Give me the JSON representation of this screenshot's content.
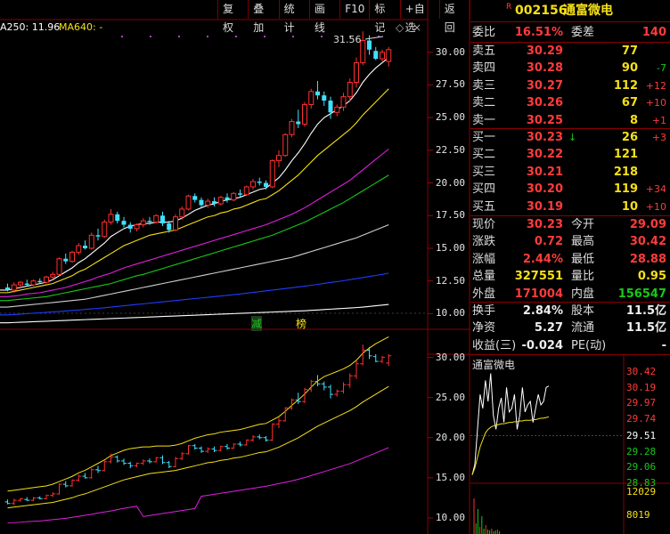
{
  "toolbar": [
    "复权",
    "叠加",
    "统计",
    "画线",
    "F10",
    "标记",
    "+自选",
    "返回"
  ],
  "ma_labels": [
    {
      "text": "A250: 11.96",
      "color": "#ffffff"
    },
    {
      "text": "MA640: -",
      "color": "#f5e016"
    }
  ],
  "annotations": {
    "high_label": "31.56",
    "marker1": "减",
    "marker2": "榜"
  },
  "stock": {
    "badge": "R",
    "code": "002156",
    "name": "通富微电"
  },
  "quote": {
    "weibi_label": "委比",
    "weibi": "16.51%",
    "weicha_label": "委差",
    "weicha": "140",
    "sells": [
      {
        "label": "卖五",
        "price": "30.29",
        "vol": "77",
        "chg": ""
      },
      {
        "label": "卖四",
        "price": "30.28",
        "vol": "90",
        "chg": "-7"
      },
      {
        "label": "卖三",
        "price": "30.27",
        "vol": "112",
        "chg": "+12"
      },
      {
        "label": "卖二",
        "price": "30.26",
        "vol": "67",
        "chg": "+10"
      },
      {
        "label": "卖一",
        "price": "30.25",
        "vol": "8",
        "chg": "+1"
      }
    ],
    "buys": [
      {
        "label": "买一",
        "price": "30.23",
        "vol": "26",
        "chg": "+3",
        "arrow": "↓"
      },
      {
        "label": "买二",
        "price": "30.22",
        "vol": "121",
        "chg": "",
        "arrow": ""
      },
      {
        "label": "买三",
        "price": "30.21",
        "vol": "218",
        "chg": "",
        "arrow": ""
      },
      {
        "label": "买四",
        "price": "30.20",
        "vol": "119",
        "chg": "+34",
        "arrow": ""
      },
      {
        "label": "买五",
        "price": "30.19",
        "vol": "10",
        "chg": "+10",
        "arrow": ""
      }
    ],
    "stats": [
      {
        "l1": "现价",
        "v1": "30.23",
        "c1": "red",
        "l2": "今开",
        "v2": "29.09",
        "c2": "red"
      },
      {
        "l1": "涨跌",
        "v1": "0.72",
        "c1": "red",
        "l2": "最高",
        "v2": "30.42",
        "c2": "red"
      },
      {
        "l1": "涨幅",
        "v1": "2.44%",
        "c1": "red",
        "l2": "最低",
        "v2": "28.88",
        "c2": "red"
      },
      {
        "l1": "总量",
        "v1": "327551",
        "c1": "yellow",
        "l2": "量比",
        "v2": "0.95",
        "c2": "yellow"
      },
      {
        "l1": "外盘",
        "v1": "171004",
        "c1": "red",
        "l2": "内盘",
        "v2": "156547",
        "c2": "green"
      }
    ],
    "stats2": [
      {
        "l1": "换手",
        "v1": "2.84%",
        "c1": "white",
        "l2": "股本",
        "v2": "11.5亿",
        "c2": "white"
      },
      {
        "l1": "净资",
        "v1": "5.27",
        "c1": "white",
        "l2": "流通",
        "v2": "11.5亿",
        "c2": "white"
      },
      {
        "l1": "收益(三)",
        "v1": "-0.024",
        "c1": "white",
        "l2": "PE(动)",
        "v2": "-",
        "c2": "white"
      }
    ]
  },
  "mini_chart": {
    "title": "通富微电",
    "price_ticks": [
      {
        "v": "30.42",
        "c": "#ff3b3b"
      },
      {
        "v": "30.19",
        "c": "#ff3b3b"
      },
      {
        "v": "29.97",
        "c": "#ff3b3b"
      },
      {
        "v": "29.74",
        "c": "#ff3b3b"
      },
      {
        "v": "29.51",
        "c": "#ffffff"
      },
      {
        "v": "29.28",
        "c": "#18c818"
      },
      {
        "v": "29.06",
        "c": "#18c818"
      },
      {
        "v": "28.83",
        "c": "#18c818"
      }
    ],
    "vol_ticks": [
      "12029",
      "8019"
    ]
  },
  "chart_data": [
    {
      "type": "candlestick",
      "title": "",
      "ylim": [
        8.8,
        32.5
      ],
      "y_ticks": [
        "30.00",
        "27.50",
        "25.00",
        "22.50",
        "20.00",
        "17.50",
        "15.00",
        "12.50",
        "10.00"
      ],
      "y_tick_values": [
        30,
        27.5,
        25,
        22.5,
        20,
        17.5,
        15,
        12.5,
        10
      ],
      "candles": [
        [
          12.0,
          12.3,
          11.7,
          11.8
        ],
        [
          11.8,
          12.4,
          11.6,
          12.2
        ],
        [
          12.2,
          12.5,
          12.0,
          12.4
        ],
        [
          12.3,
          12.6,
          12.1,
          12.2
        ],
        [
          12.2,
          12.6,
          12.1,
          12.5
        ],
        [
          12.5,
          12.7,
          12.3,
          12.4
        ],
        [
          12.4,
          12.9,
          12.3,
          12.8
        ],
        [
          12.8,
          13.2,
          12.6,
          13.0
        ],
        [
          13.0,
          14.3,
          12.9,
          14.2
        ],
        [
          14.2,
          14.6,
          13.8,
          14.0
        ],
        [
          14.0,
          14.8,
          13.9,
          14.7
        ],
        [
          14.7,
          15.4,
          14.5,
          15.2
        ],
        [
          15.2,
          15.6,
          14.9,
          15.0
        ],
        [
          15.0,
          16.2,
          14.9,
          16.0
        ],
        [
          16.0,
          16.5,
          15.6,
          15.9
        ],
        [
          15.9,
          17.2,
          15.8,
          17.0
        ],
        [
          17.0,
          18.0,
          16.8,
          17.6
        ],
        [
          17.6,
          17.8,
          16.9,
          17.1
        ],
        [
          17.1,
          17.4,
          16.6,
          16.8
        ],
        [
          16.8,
          17.0,
          16.2,
          16.5
        ],
        [
          16.5,
          16.9,
          16.3,
          16.8
        ],
        [
          16.8,
          17.3,
          16.6,
          17.1
        ],
        [
          17.1,
          17.4,
          16.8,
          17.0
        ],
        [
          17.0,
          17.6,
          16.9,
          17.5
        ],
        [
          17.5,
          17.8,
          16.7,
          16.9
        ],
        [
          16.9,
          17.1,
          16.2,
          16.4
        ],
        [
          16.4,
          17.6,
          16.3,
          17.4
        ],
        [
          17.4,
          18.2,
          17.2,
          18.0
        ],
        [
          18.0,
          19.1,
          17.9,
          19.0
        ],
        [
          19.0,
          19.2,
          18.5,
          18.7
        ],
        [
          18.7,
          18.9,
          18.1,
          18.3
        ],
        [
          18.3,
          18.8,
          18.1,
          18.6
        ],
        [
          18.6,
          18.9,
          18.2,
          18.4
        ],
        [
          18.4,
          19.0,
          18.3,
          18.9
        ],
        [
          18.9,
          19.2,
          18.5,
          18.7
        ],
        [
          18.7,
          19.3,
          18.6,
          19.2
        ],
        [
          19.2,
          19.5,
          18.9,
          19.1
        ],
        [
          19.1,
          19.8,
          19.0,
          19.7
        ],
        [
          19.7,
          20.3,
          19.5,
          20.1
        ],
        [
          20.1,
          20.4,
          19.8,
          20.0
        ],
        [
          20.0,
          20.2,
          19.5,
          19.7
        ],
        [
          19.7,
          21.8,
          19.6,
          21.7
        ],
        [
          21.7,
          22.5,
          21.2,
          22.1
        ],
        [
          22.1,
          23.8,
          22.0,
          23.7
        ],
        [
          23.7,
          24.9,
          23.5,
          24.7
        ],
        [
          24.7,
          25.6,
          24.2,
          24.5
        ],
        [
          24.5,
          26.2,
          24.3,
          26.0
        ],
        [
          26.0,
          27.2,
          25.7,
          27.0
        ],
        [
          27.0,
          27.8,
          26.4,
          26.7
        ],
        [
          26.7,
          27.0,
          25.9,
          26.3
        ],
        [
          26.3,
          26.6,
          24.9,
          25.4
        ],
        [
          25.4,
          26.0,
          25.1,
          25.8
        ],
        [
          25.8,
          26.9,
          25.5,
          26.6
        ],
        [
          26.6,
          28.0,
          26.2,
          27.7
        ],
        [
          27.7,
          29.6,
          27.3,
          29.2
        ],
        [
          29.2,
          31.6,
          29.0,
          30.9
        ],
        [
          30.9,
          31.3,
          29.8,
          30.2
        ],
        [
          30.1,
          30.4,
          29.4,
          29.5
        ],
        [
          29.5,
          30.2,
          29.3,
          30.0
        ],
        [
          29.3,
          30.4,
          28.9,
          30.2
        ]
      ],
      "ma": [
        {
          "color": "#ffffff",
          "values": [
            11.8,
            11.9,
            12.0,
            12.1,
            12.2,
            12.3,
            12.4,
            12.6,
            12.9,
            13.2,
            13.5,
            13.9,
            14.2,
            14.6,
            15.0,
            15.4,
            15.9,
            16.2,
            16.5,
            16.7,
            16.8,
            16.9,
            16.9,
            17.0,
            17.0,
            17.0,
            17.1,
            17.3,
            17.6,
            17.9,
            18.1,
            18.3,
            18.4,
            18.6,
            18.7,
            18.8,
            18.9,
            19.1,
            19.3,
            19.5,
            19.6,
            20.0,
            20.4,
            21.0,
            21.7,
            22.3,
            23.0,
            23.8,
            24.5,
            25.0,
            25.3,
            25.6,
            25.9,
            26.3,
            26.9,
            27.7,
            28.3,
            28.8,
            29.2,
            29.6
          ]
        },
        {
          "color": "#f5e016",
          "values": [
            11.6,
            11.7,
            11.8,
            11.9,
            12.0,
            12.1,
            12.2,
            12.3,
            12.5,
            12.7,
            12.9,
            13.2,
            13.4,
            13.7,
            14.0,
            14.3,
            14.6,
            14.9,
            15.2,
            15.4,
            15.6,
            15.8,
            16.0,
            16.1,
            16.2,
            16.3,
            16.4,
            16.6,
            16.8,
            17.0,
            17.2,
            17.4,
            17.5,
            17.7,
            17.8,
            18.0,
            18.1,
            18.3,
            18.5,
            18.7,
            18.8,
            19.1,
            19.4,
            19.8,
            20.2,
            20.6,
            21.1,
            21.6,
            22.1,
            22.5,
            22.9,
            23.3,
            23.7,
            24.1,
            24.6,
            25.2,
            25.7,
            26.2,
            26.7,
            27.2
          ]
        },
        {
          "color": "#e020e0",
          "values": [
            11.3,
            11.35,
            11.4,
            11.5,
            11.55,
            11.6,
            11.7,
            11.8,
            11.9,
            12.0,
            12.15,
            12.3,
            12.45,
            12.6,
            12.8,
            12.95,
            13.1,
            13.3,
            13.5,
            13.65,
            13.8,
            13.95,
            14.1,
            14.25,
            14.4,
            14.55,
            14.7,
            14.85,
            15.0,
            15.15,
            15.3,
            15.45,
            15.6,
            15.75,
            15.9,
            16.05,
            16.2,
            16.35,
            16.5,
            16.65,
            16.8,
            17.0,
            17.2,
            17.4,
            17.6,
            17.85,
            18.1,
            18.4,
            18.7,
            19.0,
            19.3,
            19.6,
            19.9,
            20.2,
            20.6,
            21.0,
            21.4,
            21.8,
            22.2,
            22.6
          ]
        },
        {
          "color": "#18c818",
          "values": [
            11.0,
            11.05,
            11.1,
            11.15,
            11.2,
            11.25,
            11.3,
            11.4,
            11.5,
            11.6,
            11.7,
            11.8,
            11.9,
            12.0,
            12.1,
            12.2,
            12.3,
            12.45,
            12.6,
            12.75,
            12.9,
            13.0,
            13.15,
            13.3,
            13.45,
            13.6,
            13.75,
            13.9,
            14.05,
            14.2,
            14.35,
            14.5,
            14.65,
            14.8,
            14.95,
            15.1,
            15.25,
            15.4,
            15.55,
            15.7,
            15.85,
            16.0,
            16.2,
            16.4,
            16.6,
            16.8,
            17.0,
            17.25,
            17.5,
            17.75,
            18.0,
            18.25,
            18.5,
            18.8,
            19.1,
            19.4,
            19.7,
            20.0,
            20.3,
            20.6
          ]
        },
        {
          "color": "#cfcfcf",
          "values": [
            10.5,
            10.55,
            10.6,
            10.65,
            10.7,
            10.75,
            10.8,
            10.85,
            10.9,
            10.95,
            11.0,
            11.05,
            11.1,
            11.2,
            11.3,
            11.4,
            11.5,
            11.6,
            11.7,
            11.8,
            11.9,
            12.0,
            12.1,
            12.2,
            12.3,
            12.4,
            12.5,
            12.6,
            12.7,
            12.8,
            12.9,
            13.0,
            13.1,
            13.2,
            13.3,
            13.4,
            13.5,
            13.6,
            13.7,
            13.8,
            13.9,
            14.0,
            14.1,
            14.2,
            14.3,
            14.45,
            14.6,
            14.75,
            14.9,
            15.05,
            15.2,
            15.35,
            15.5,
            15.65,
            15.8,
            16.0,
            16.2,
            16.4,
            16.6,
            16.8
          ]
        },
        {
          "color": "#1e3cff",
          "values": [
            9.9,
            9.93,
            9.96,
            10.0,
            10.03,
            10.06,
            10.1,
            10.13,
            10.16,
            10.2,
            10.24,
            10.28,
            10.32,
            10.36,
            10.4,
            10.45,
            10.5,
            10.55,
            10.6,
            10.65,
            10.7,
            10.75,
            10.8,
            10.85,
            10.9,
            10.95,
            11.0,
            11.05,
            11.1,
            11.15,
            11.2,
            11.25,
            11.3,
            11.35,
            11.4,
            11.45,
            11.5,
            11.56,
            11.62,
            11.68,
            11.74,
            11.8,
            11.86,
            11.92,
            11.98,
            12.04,
            12.1,
            12.17,
            12.24,
            12.31,
            12.38,
            12.45,
            12.52,
            12.6,
            12.68,
            12.76,
            12.84,
            12.92,
            13.0,
            13.1
          ]
        },
        {
          "color": "#ffffff",
          "values": [
            9.3,
            9.32,
            9.34,
            9.36,
            9.38,
            9.4,
            9.42,
            9.44,
            9.46,
            9.48,
            9.5,
            9.52,
            9.54,
            9.56,
            9.58,
            9.6,
            9.62,
            9.64,
            9.66,
            9.68,
            9.7,
            9.72,
            9.74,
            9.76,
            9.78,
            9.8,
            9.82,
            9.84,
            9.86,
            9.88,
            9.9,
            9.92,
            9.94,
            9.96,
            9.98,
            10.0,
            10.02,
            10.04,
            10.06,
            10.08,
            10.1,
            10.12,
            10.14,
            10.16,
            10.18,
            10.2,
            10.22,
            10.25,
            10.28,
            10.31,
            10.34,
            10.37,
            10.4,
            10.43,
            10.46,
            10.5,
            10.55,
            10.6,
            10.65,
            10.7
          ]
        }
      ]
    },
    {
      "type": "ohlc",
      "title": "",
      "ylim": [
        8.0,
        33.5
      ],
      "y_ticks": [
        "30.00",
        "25.00",
        "20.00",
        "15.00",
        "10.00"
      ],
      "y_tick_values": [
        30,
        25,
        20,
        15,
        10
      ],
      "upper_band_color": "#f5e016",
      "mid_band_color": "#f5e016",
      "lower_band_color": "#e020e0"
    },
    {
      "type": "line",
      "title": "通富微电",
      "ylim": [
        28.83,
        30.42
      ],
      "values": [
        28.95,
        29.1,
        29.6,
        30.1,
        29.9,
        30.3,
        30.0,
        30.4,
        29.8,
        29.6,
        29.9,
        30.05,
        29.7,
        30.2,
        29.85,
        29.9,
        30.1,
        29.6,
        29.8,
        30.2,
        29.85,
        29.95,
        30.0,
        29.7,
        29.9,
        30.1,
        29.95,
        30.0,
        30.2,
        30.22
      ],
      "avg": [
        28.95,
        29.05,
        29.2,
        29.35,
        29.45,
        29.55,
        29.6,
        29.63,
        29.65,
        29.66,
        29.67,
        29.68,
        29.68,
        29.69,
        29.7,
        29.7,
        29.71,
        29.71,
        29.72,
        29.72,
        29.73,
        29.73,
        29.73,
        29.74,
        29.74,
        29.75,
        29.76,
        29.76,
        29.77,
        29.78
      ]
    }
  ]
}
